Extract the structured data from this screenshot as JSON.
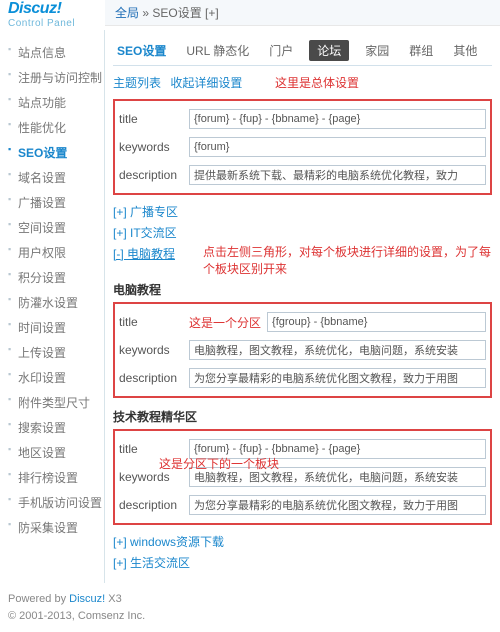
{
  "logo": {
    "title": "Discuz!",
    "sub": "Control Panel"
  },
  "breadcrumb": {
    "home": "全局",
    "sep": " » ",
    "current": "SEO设置",
    "suffix": "  [+]"
  },
  "sidebar": {
    "items": [
      {
        "label": "站点信息"
      },
      {
        "label": "注册与访问控制"
      },
      {
        "label": "站点功能"
      },
      {
        "label": "性能优化"
      },
      {
        "label": "SEO设置"
      },
      {
        "label": "域名设置"
      },
      {
        "label": "广播设置"
      },
      {
        "label": "空间设置"
      },
      {
        "label": "用户权限"
      },
      {
        "label": "积分设置"
      },
      {
        "label": "防灌水设置"
      },
      {
        "label": "时间设置"
      },
      {
        "label": "上传设置"
      },
      {
        "label": "水印设置"
      },
      {
        "label": "附件类型尺寸"
      },
      {
        "label": "搜索设置"
      },
      {
        "label": "地区设置"
      },
      {
        "label": "排行榜设置"
      },
      {
        "label": "手机版访问设置"
      },
      {
        "label": "防采集设置"
      }
    ],
    "activeIndex": 4
  },
  "tabs": {
    "items": [
      "SEO设置",
      "URL 静态化",
      "门户",
      "论坛",
      "家园",
      "群组",
      "其他"
    ],
    "activeIndex": 3
  },
  "sublinks": {
    "a": "主题列表",
    "b": "收起详细设置"
  },
  "annotations": {
    "top": "这里是总体设置",
    "mid": "点击左侧三角形，对每个板块进行详细的设置，为了每个板块区别开来",
    "box2": "这是一个分区",
    "box3": "这是分区下的一个板块"
  },
  "labels": {
    "title": "title",
    "keywords": "keywords",
    "description": "description"
  },
  "global": {
    "title": "{forum} - {fup} - {bbname} - {page}",
    "keywords": "{forum}",
    "description": "提供最新系统下载、最精彩的电脑系统优化教程，致力"
  },
  "toggles": {
    "t1": "[+]  广播专区",
    "t2": "[+]  IT交流区",
    "t3": "[-]  电脑教程",
    "t4": "[+]  windows资源下载",
    "t5": "[+]  生活交流区"
  },
  "section1_title": "电脑教程",
  "section1": {
    "title": "{fgroup} - {bbname}",
    "keywords": "电脑教程，图文教程，系统优化，电脑问题，系统安装",
    "description": "为您分享最精彩的电脑系统优化图文教程，致力于用图"
  },
  "section2_title": "技术教程精华区",
  "section2": {
    "title": "{forum} - {fup} - {bbname} - {page}",
    "keywords": "电脑教程，图文教程，系统优化，电脑问题，系统安装",
    "description": "为您分享最精彩的电脑系统优化图文教程，致力于用图"
  },
  "footer": {
    "line1_a": "Powered by ",
    "line1_b": "Discuz!",
    "line1_c": " X3",
    "line2": "© 2001-2013, Comsenz Inc."
  }
}
